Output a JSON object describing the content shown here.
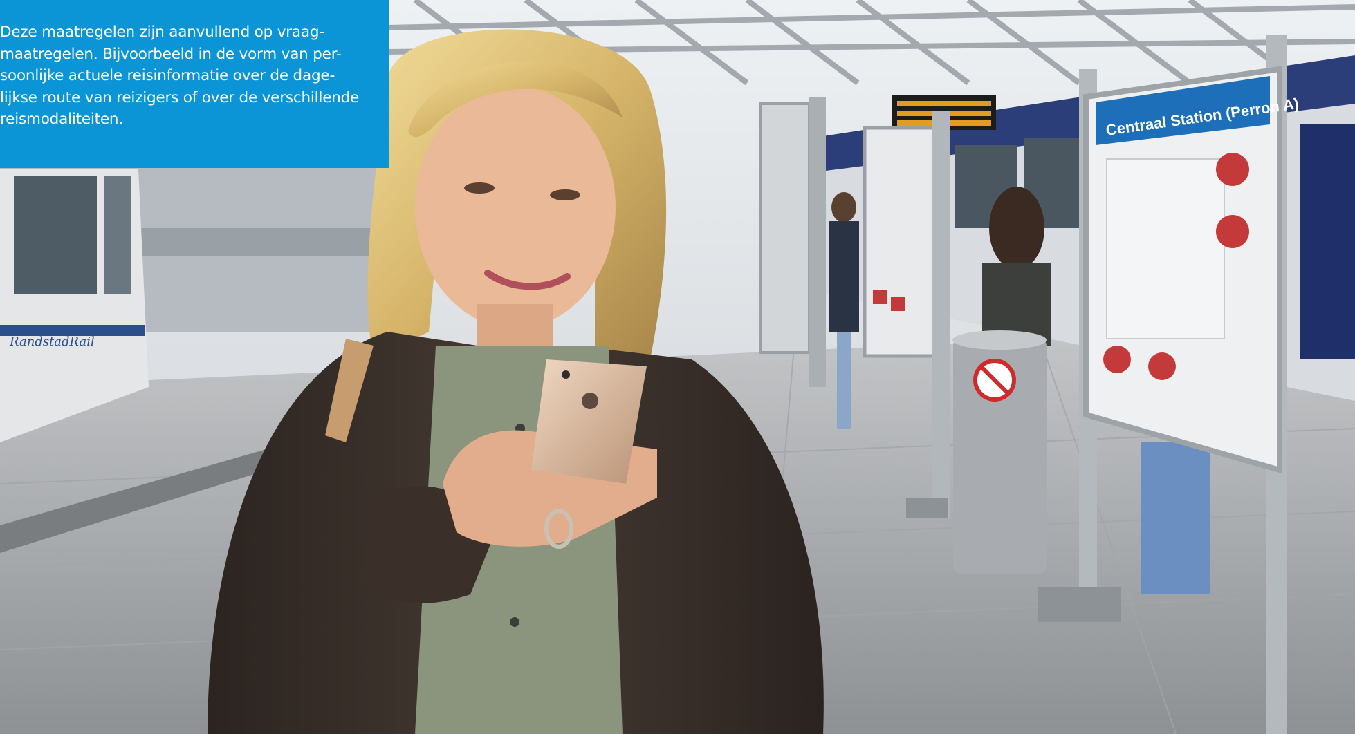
{
  "caption": {
    "lines": [
      "Deze maatregelen zijn aanvullend op vraag-",
      "maatregelen. Bijvoorbeeld in de vorm van per-",
      "soonlijke actuele reisinformatie over de dage-",
      "lijkse route van reizigers of over de verschillende",
      "reismodaliteiten."
    ]
  },
  "photo": {
    "sign_title": "Centraal Station (Perron A)",
    "tram_brand": "RandstadRail"
  },
  "colors": {
    "caption_background": "#0b95d6",
    "caption_text": "#ffffff"
  }
}
